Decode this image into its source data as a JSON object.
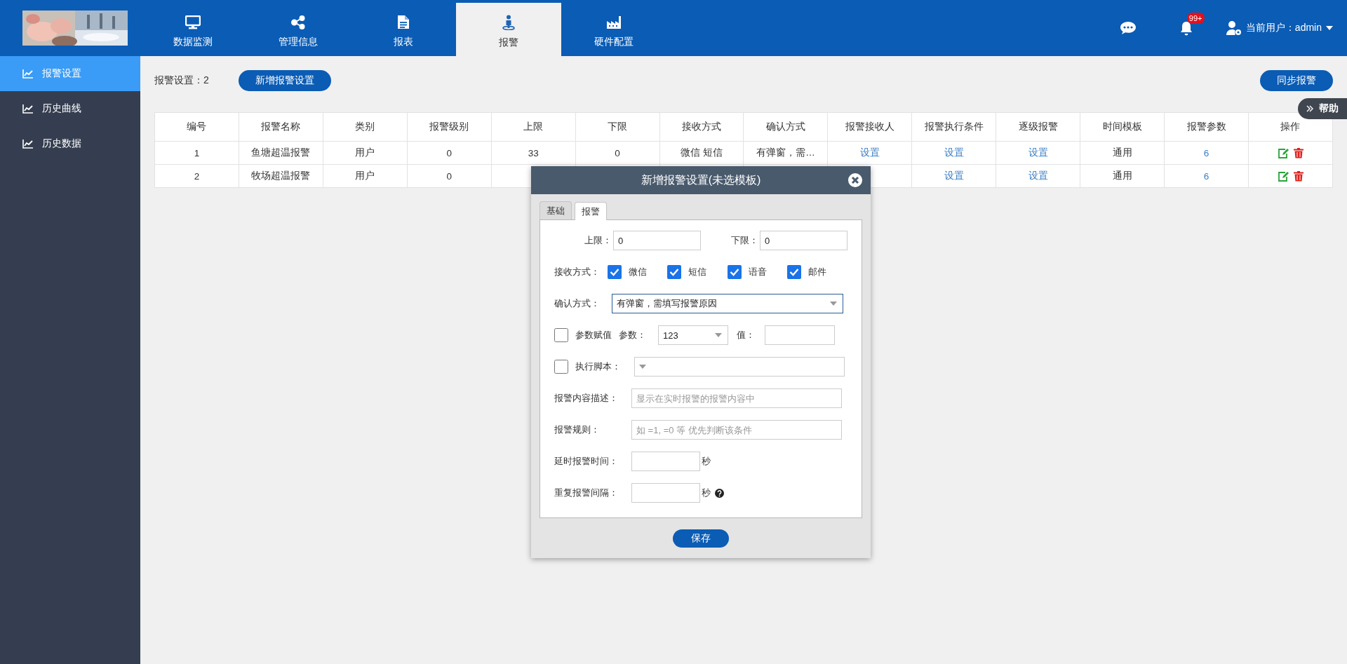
{
  "header": {
    "nav": [
      {
        "label": "数据监测",
        "selected": false
      },
      {
        "label": "管理信息",
        "selected": false
      },
      {
        "label": "报表",
        "selected": false
      },
      {
        "label": "报警",
        "selected": true
      },
      {
        "label": "硬件配置",
        "selected": false
      }
    ],
    "notification_badge": "99+",
    "user": "当前用户：admin"
  },
  "sidebar": {
    "items": [
      {
        "label": "报警设置",
        "selected": true
      },
      {
        "label": "历史曲线",
        "selected": false
      },
      {
        "label": "历史数据",
        "selected": false
      }
    ]
  },
  "toolbar": {
    "count": "报警设置：2",
    "add_button": "新增报警设置",
    "sync_button": "同步报警"
  },
  "help_tab": "帮助",
  "table": {
    "columns": [
      "编号",
      "报警名称",
      "类别",
      "报警级别",
      "上限",
      "下限",
      "接收方式",
      "确认方式",
      "报警接收人",
      "报警执行条件",
      "逐级报警",
      "时间模板",
      "报警参数",
      "操作"
    ],
    "rows": [
      {
        "cells": [
          {
            "kind": "text",
            "text": "1"
          },
          {
            "kind": "text",
            "text": "鱼塘超温报警"
          },
          {
            "kind": "text",
            "text": "用户"
          },
          {
            "kind": "text",
            "text": "0"
          },
          {
            "kind": "text",
            "text": "33"
          },
          {
            "kind": "text",
            "text": "0"
          },
          {
            "kind": "text",
            "text": "微信  短信"
          },
          {
            "kind": "text",
            "text": "有弹窗，需…"
          },
          {
            "kind": "link",
            "text": "设置"
          },
          {
            "kind": "link",
            "text": "设置"
          },
          {
            "kind": "link",
            "text": "设置"
          },
          {
            "kind": "text",
            "text": "通用"
          },
          {
            "kind": "link",
            "text": "6"
          },
          {
            "kind": "actions"
          }
        ]
      },
      {
        "cells": [
          {
            "kind": "text",
            "text": "2"
          },
          {
            "kind": "text",
            "text": "牧场超温报警"
          },
          {
            "kind": "text",
            "text": "用户"
          },
          {
            "kind": "text",
            "text": "0"
          },
          {
            "kind": "covered"
          },
          {
            "kind": "covered"
          },
          {
            "kind": "covered"
          },
          {
            "kind": "covered"
          },
          {
            "kind": "covered"
          },
          {
            "kind": "link",
            "text": "设置"
          },
          {
            "kind": "link",
            "text": "设置"
          },
          {
            "kind": "text",
            "text": "通用"
          },
          {
            "kind": "link",
            "text": "6"
          },
          {
            "kind": "actions"
          }
        ]
      }
    ]
  },
  "dialog": {
    "title": "新增报警设置(未选模板)",
    "tabs": [
      {
        "label": "基础",
        "selected": false
      },
      {
        "label": "报警",
        "selected": true
      }
    ],
    "rows": [
      {
        "kind": "pair",
        "items": [
          {
            "label": "上限：",
            "value": "0"
          },
          {
            "label": "下限：",
            "value": "0"
          }
        ]
      },
      {
        "kind": "checks",
        "label": "接收方式：",
        "options": [
          {
            "label": "微信",
            "checked": true
          },
          {
            "label": "短信",
            "checked": true
          },
          {
            "label": "语音",
            "checked": true
          },
          {
            "label": "邮件",
            "checked": true
          }
        ]
      },
      {
        "kind": "select",
        "label": "确认方式：",
        "value": "有弹窗，需填写报警原因"
      },
      {
        "kind": "param",
        "checked": false,
        "label": "参数赋值",
        "param_label": "参数：",
        "param_value": "123",
        "value_label": "值："
      },
      {
        "kind": "script",
        "checked": false,
        "label": "执行脚本："
      },
      {
        "kind": "text",
        "label": "报警内容描述：",
        "placeholder": "显示在实时报警的报警内容中"
      },
      {
        "kind": "text",
        "label": "报警规则：",
        "placeholder": "如 =1, =0 等 优先判断该条件"
      },
      {
        "kind": "seconds",
        "label": "延时报警时间：",
        "unit": "秒",
        "help": false
      },
      {
        "kind": "seconds",
        "label": "重复报警间隔：",
        "unit": "秒",
        "help": true
      }
    ],
    "save_button": "保存"
  }
}
